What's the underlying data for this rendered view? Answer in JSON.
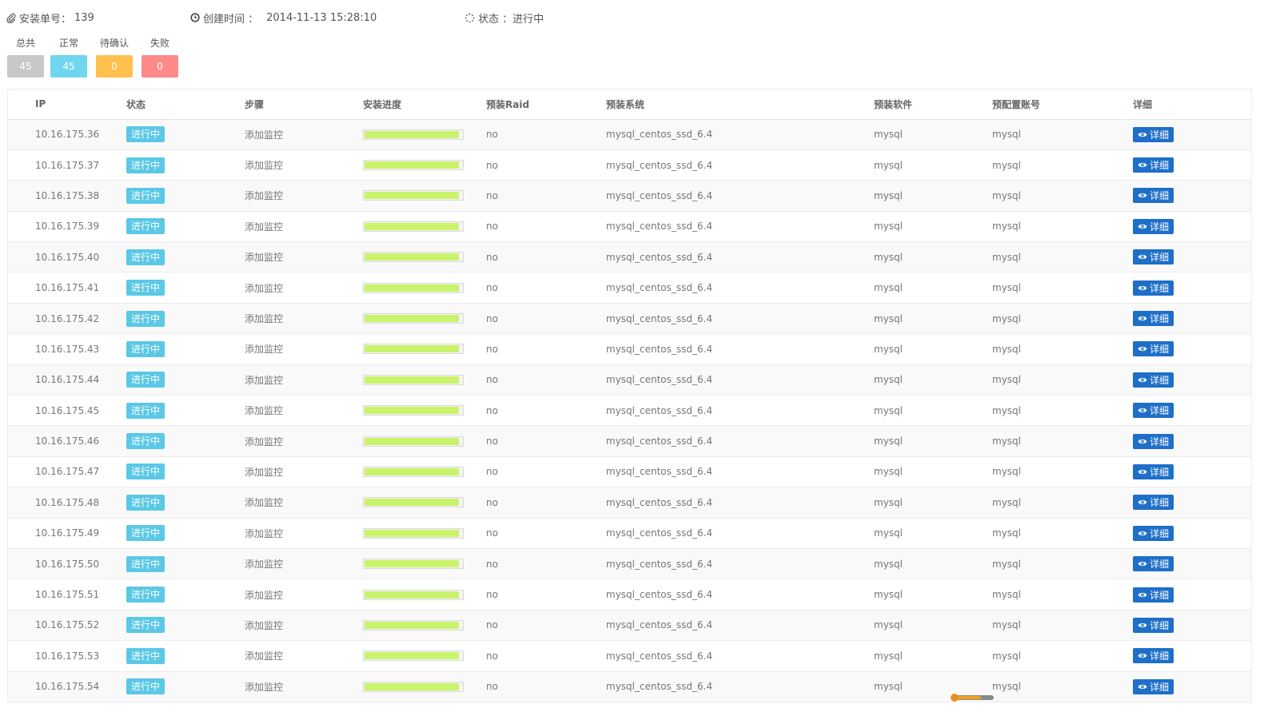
{
  "header": {
    "order_label": "安装单号：",
    "order_value": "139",
    "created_label": "创建时间 ：",
    "created_value": "2014-11-13 15:28:10",
    "status_label": "状态 ：",
    "status_value": "进行中",
    "order_icon": "paperclip-icon",
    "created_icon": "clock-icon",
    "status_icon": "spinner-icon"
  },
  "counters": [
    {
      "label": "总共",
      "value": "45",
      "color": "#c8c8c8"
    },
    {
      "label": "正常",
      "value": "45",
      "color": "#6fd6ef"
    },
    {
      "label": "待确认",
      "value": "0",
      "color": "#ffc04d"
    },
    {
      "label": "失败",
      "value": "0",
      "color": "#ff8a8a"
    }
  ],
  "table": {
    "headers": [
      "IP",
      "状态",
      "步骤",
      "安装进度",
      "预装Raid",
      "预装系统",
      "预装软件",
      "预配置账号",
      "详细"
    ],
    "rows": [
      {
        "ip": "10.16.175.36",
        "status": "进行中",
        "step": "添加监控",
        "progress": 0.97,
        "raid": "no",
        "system": "mysql_centos_ssd_6.4",
        "software": "mysql",
        "account": "mysql",
        "detail": "详细"
      },
      {
        "ip": "10.16.175.37",
        "status": "进行中",
        "step": "添加监控",
        "progress": 0.97,
        "raid": "no",
        "system": "mysql_centos_ssd_6.4",
        "software": "mysql",
        "account": "mysql",
        "detail": "详细"
      },
      {
        "ip": "10.16.175.38",
        "status": "进行中",
        "step": "添加监控",
        "progress": 0.97,
        "raid": "no",
        "system": "mysql_centos_ssd_6.4",
        "software": "mysql",
        "account": "mysql",
        "detail": "详细"
      },
      {
        "ip": "10.16.175.39",
        "status": "进行中",
        "step": "添加监控",
        "progress": 0.97,
        "raid": "no",
        "system": "mysql_centos_ssd_6.4",
        "software": "mysql",
        "account": "mysql",
        "detail": "详细"
      },
      {
        "ip": "10.16.175.40",
        "status": "进行中",
        "step": "添加监控",
        "progress": 0.97,
        "raid": "no",
        "system": "mysql_centos_ssd_6.4",
        "software": "mysql",
        "account": "mysql",
        "detail": "详细"
      },
      {
        "ip": "10.16.175.41",
        "status": "进行中",
        "step": "添加监控",
        "progress": 0.97,
        "raid": "no",
        "system": "mysql_centos_ssd_6.4",
        "software": "mysql",
        "account": "mysql",
        "detail": "详细"
      },
      {
        "ip": "10.16.175.42",
        "status": "进行中",
        "step": "添加监控",
        "progress": 0.97,
        "raid": "no",
        "system": "mysql_centos_ssd_6.4",
        "software": "mysql",
        "account": "mysql",
        "detail": "详细"
      },
      {
        "ip": "10.16.175.43",
        "status": "进行中",
        "step": "添加监控",
        "progress": 0.97,
        "raid": "no",
        "system": "mysql_centos_ssd_6.4",
        "software": "mysql",
        "account": "mysql",
        "detail": "详细"
      },
      {
        "ip": "10.16.175.44",
        "status": "进行中",
        "step": "添加监控",
        "progress": 0.97,
        "raid": "no",
        "system": "mysql_centos_ssd_6.4",
        "software": "mysql",
        "account": "mysql",
        "detail": "详细"
      },
      {
        "ip": "10.16.175.45",
        "status": "进行中",
        "step": "添加监控",
        "progress": 0.97,
        "raid": "no",
        "system": "mysql_centos_ssd_6.4",
        "software": "mysql",
        "account": "mysql",
        "detail": "详细"
      },
      {
        "ip": "10.16.175.46",
        "status": "进行中",
        "step": "添加监控",
        "progress": 0.97,
        "raid": "no",
        "system": "mysql_centos_ssd_6.4",
        "software": "mysql",
        "account": "mysql",
        "detail": "详细"
      },
      {
        "ip": "10.16.175.47",
        "status": "进行中",
        "step": "添加监控",
        "progress": 0.97,
        "raid": "no",
        "system": "mysql_centos_ssd_6.4",
        "software": "mysql",
        "account": "mysql",
        "detail": "详细"
      },
      {
        "ip": "10.16.175.48",
        "status": "进行中",
        "step": "添加监控",
        "progress": 0.97,
        "raid": "no",
        "system": "mysql_centos_ssd_6.4",
        "software": "mysql",
        "account": "mysql",
        "detail": "详细"
      },
      {
        "ip": "10.16.175.49",
        "status": "进行中",
        "step": "添加监控",
        "progress": 0.97,
        "raid": "no",
        "system": "mysql_centos_ssd_6.4",
        "software": "mysql",
        "account": "mysql",
        "detail": "详细"
      },
      {
        "ip": "10.16.175.50",
        "status": "进行中",
        "step": "添加监控",
        "progress": 0.97,
        "raid": "no",
        "system": "mysql_centos_ssd_6.4",
        "software": "mysql",
        "account": "mysql",
        "detail": "详细"
      },
      {
        "ip": "10.16.175.51",
        "status": "进行中",
        "step": "添加监控",
        "progress": 0.97,
        "raid": "no",
        "system": "mysql_centos_ssd_6.4",
        "software": "mysql",
        "account": "mysql",
        "detail": "详细"
      },
      {
        "ip": "10.16.175.52",
        "status": "进行中",
        "step": "添加监控",
        "progress": 0.97,
        "raid": "no",
        "system": "mysql_centos_ssd_6.4",
        "software": "mysql",
        "account": "mysql",
        "detail": "详细"
      },
      {
        "ip": "10.16.175.53",
        "status": "进行中",
        "step": "添加监控",
        "progress": 0.97,
        "raid": "no",
        "system": "mysql_centos_ssd_6.4",
        "software": "mysql",
        "account": "mysql",
        "detail": "详细"
      },
      {
        "ip": "10.16.175.54",
        "status": "进行中",
        "step": "添加监控",
        "progress": 0.97,
        "raid": "no",
        "system": "mysql_centos_ssd_6.4",
        "software": "mysql",
        "account": "mysql",
        "detail": "详细"
      }
    ],
    "detail_icon": "eye-icon"
  },
  "colors": {
    "status_badge": "#5bc8e6",
    "progress_fill": "#c9f36a",
    "detail_button": "#1e6fc8"
  }
}
